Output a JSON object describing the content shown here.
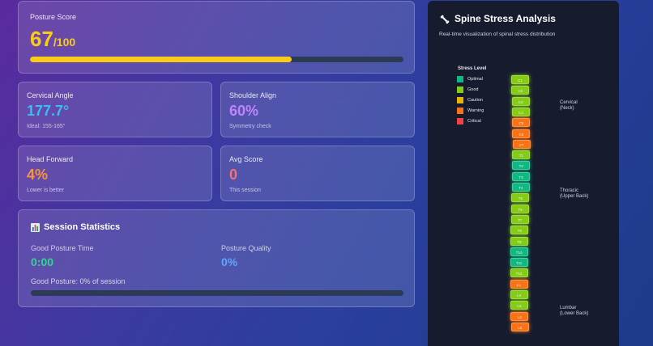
{
  "posture": {
    "label": "Posture Score",
    "score": "67",
    "max": "/100",
    "progress": 0.7
  },
  "metrics": [
    {
      "label": "Cervical Angle",
      "value": "177.7°",
      "sub": "Ideal: 155-165°",
      "color": "#38bdf8"
    },
    {
      "label": "Shoulder Align",
      "value": "60%",
      "sub": "Symmetry check",
      "color": "#c084fc"
    },
    {
      "label": "Head Forward",
      "value": "4%",
      "sub": "Lower is better",
      "color": "#fb923c"
    },
    {
      "label": "Avg Score",
      "value": "0",
      "sub": "This session",
      "color": "#f87171"
    }
  ],
  "session": {
    "icon": "bar-chart-icon",
    "title": "Session Statistics",
    "time_label": "Good Posture Time",
    "time_value": "0:00",
    "quality_label": "Posture Quality",
    "quality_value": "0%",
    "summary": "Good Posture: 0% of session",
    "progress": 0
  },
  "spine": {
    "icon": "bone-icon",
    "title": "Spine Stress Analysis",
    "subtitle": "Real-time visualization of spinal stress distribution",
    "legend_title": "Stress Level",
    "legend": [
      {
        "label": "Optimal",
        "color": "#10b981"
      },
      {
        "label": "Good",
        "color": "#84cc16"
      },
      {
        "label": "Caution",
        "color": "#eab308"
      },
      {
        "label": "Warning",
        "color": "#f97316"
      },
      {
        "label": "Critical",
        "color": "#ef4444"
      }
    ],
    "regions": [
      {
        "line1": "Cervical",
        "line2": "(Neck)"
      },
      {
        "line1": "Thoracic",
        "line2": "(Upper Back)"
      },
      {
        "line1": "Lumbar",
        "line2": "(Lower Back)"
      }
    ],
    "vertebrae": [
      {
        "label": "C1",
        "level": "Good"
      },
      {
        "label": "C2",
        "level": "Good"
      },
      {
        "label": "C3",
        "level": "Good"
      },
      {
        "label": "C4",
        "level": "Good"
      },
      {
        "label": "C5",
        "level": "Warning"
      },
      {
        "label": "C6",
        "level": "Warning"
      },
      {
        "label": "C7",
        "level": "Warning"
      },
      {
        "label": "T1",
        "level": "Good"
      },
      {
        "label": "T2",
        "level": "Optimal"
      },
      {
        "label": "T3",
        "level": "Optimal"
      },
      {
        "label": "T4",
        "level": "Optimal"
      },
      {
        "label": "T5",
        "level": "Good"
      },
      {
        "label": "T6",
        "level": "Good"
      },
      {
        "label": "T7",
        "level": "Good"
      },
      {
        "label": "T8",
        "level": "Good"
      },
      {
        "label": "T9",
        "level": "Good"
      },
      {
        "label": "T10",
        "level": "Optimal"
      },
      {
        "label": "T11",
        "level": "Optimal"
      },
      {
        "label": "T12",
        "level": "Good"
      },
      {
        "label": "L1",
        "level": "Warning"
      },
      {
        "label": "L2",
        "level": "Good"
      },
      {
        "label": "L3",
        "level": "Good"
      },
      {
        "label": "L4",
        "level": "Warning"
      },
      {
        "label": "L5",
        "level": "Warning"
      }
    ]
  }
}
